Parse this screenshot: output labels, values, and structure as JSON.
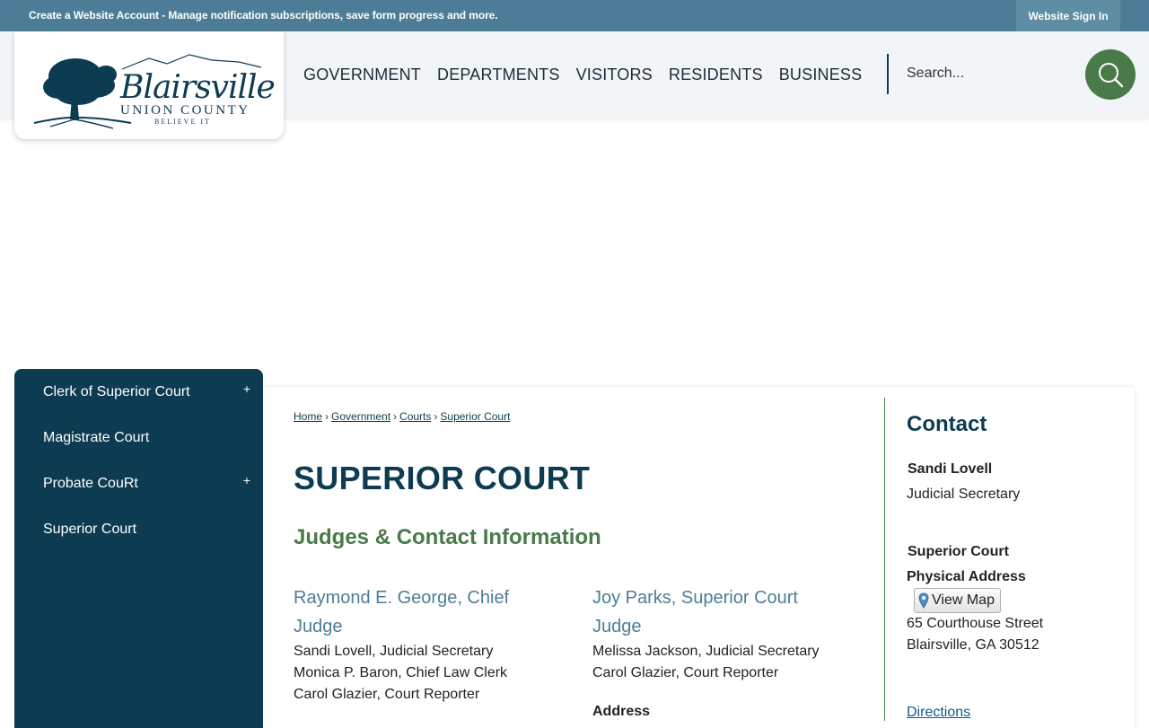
{
  "topbar": {
    "account_link": "Create a Website Account - Manage notification subscriptions, save form progress and more.",
    "signin": "Website Sign In"
  },
  "logo": {
    "script": "Blairsville",
    "county": "UNION COUNTY",
    "tagline": "BELIEVE IT"
  },
  "nav": [
    "GOVERNMENT",
    "DEPARTMENTS",
    "VISITORS",
    "RESIDENTS",
    "BUSINESS"
  ],
  "search": {
    "placeholder": "Search..."
  },
  "sidebar": {
    "items": [
      {
        "label": "Clerk of Superior Court",
        "expand": "+"
      },
      {
        "label": "Magistrate Court"
      },
      {
        "label": "Probate CouRt",
        "expand": "+"
      },
      {
        "label": "Superior Court"
      }
    ]
  },
  "breadcrumb": [
    "Home",
    "Government",
    "Courts",
    "Superior Court"
  ],
  "breadcrumb_sep": "›",
  "page_title": "SUPERIOR COURT",
  "section_heading": "Judges & Contact Information",
  "judges": [
    {
      "name": "Raymond E. George, Chief Judge",
      "staff": [
        "Sandi Lovell, Judicial Secretary",
        "Monica P. Baron, Chief Law Clerk",
        "Carol Glazier, Court Reporter"
      ]
    },
    {
      "name": "Joy Parks, Superior Court Judge",
      "staff": [
        "Melissa Jackson, Judicial Secretary",
        "Carol Glazier, Court Reporter"
      ]
    }
  ],
  "address_label": "Address",
  "contact": {
    "heading": "Contact",
    "person": "Sandi Lovell",
    "role": "Judicial Secretary",
    "org": "Superior Court",
    "address_label": "Physical Address",
    "map_button": "View Map",
    "street": "65 Courthouse Street",
    "city": "Blairsville, GA 30512",
    "directions": "Directions"
  },
  "colors": {
    "topbar": "#4d7d96",
    "navy": "#0d3c52",
    "green": "#4a7a4a",
    "link_blue": "#4d7d96"
  }
}
